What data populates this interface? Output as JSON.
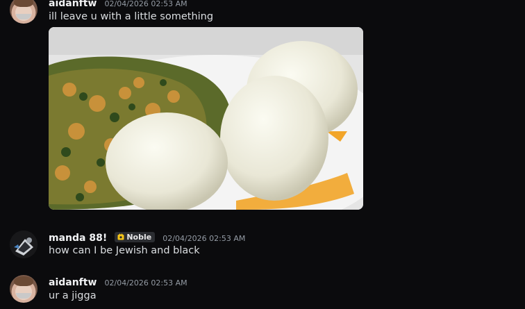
{
  "messages": [
    {
      "username": "aidanftw",
      "timestamp": "02/04/2026 02:53 AM",
      "text": "ill leave u with a little something",
      "avatar_icon": "avatar-aidanftw",
      "attachment": {
        "type": "image",
        "icon": "food-image"
      }
    },
    {
      "username": "manda 88!",
      "badge": {
        "label": "Noble",
        "icon": "noble-badge-icon",
        "color": "#f5c518"
      },
      "timestamp": "02/04/2026 02:53 AM",
      "text": "how can I be Jewish and black",
      "avatar_icon": "avatar-manda"
    },
    {
      "username": "aidanftw",
      "timestamp": "02/04/2026 02:53 AM",
      "text": "ur a jigga",
      "avatar_icon": "avatar-aidanftw"
    }
  ],
  "colors": {
    "background": "#0b0b0d",
    "username": "#f2f3f5",
    "timestamp": "#949ba4",
    "message_text": "#dbdee1"
  }
}
